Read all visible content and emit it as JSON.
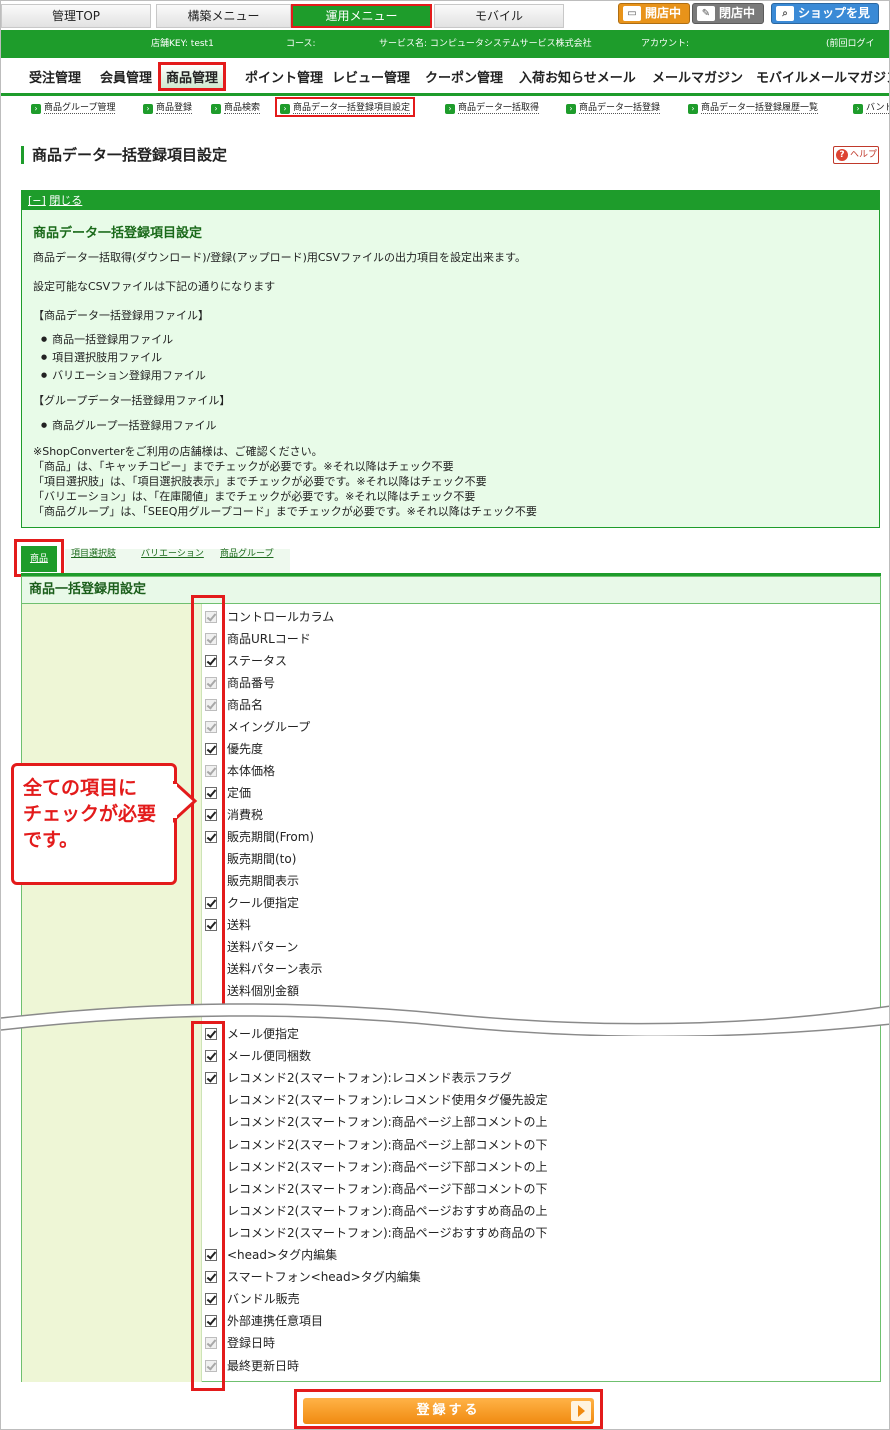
{
  "top_tabs": [
    "管理TOP",
    "構築メニュー",
    "運用メニュー",
    "モバイル"
  ],
  "shop_buttons": [
    "開店中",
    "閉店中",
    "ショップを見る"
  ],
  "info_bar": {
    "store_key": "店舗KEY: test1",
    "course": "コース:",
    "service": "サービス名: コンピュータシステムサービス株式会社",
    "account": "アカウント:",
    "last_login": "(前回ログイ"
  },
  "main_nav": [
    "受注管理",
    "会員管理",
    "商品管理",
    "ポイント管理",
    "レビュー管理",
    "クーポン管理",
    "入荷お知らせメール",
    "メールマガジン",
    "モバイルメールマガジン"
  ],
  "sub_nav": [
    "商品グループ管理",
    "商品登録",
    "商品検索",
    "商品データ一括登録項目設定",
    "商品データ一括取得",
    "商品データ一括登録",
    "商品データ一括登録履歴一覧",
    "バンド"
  ],
  "page": {
    "title": "商品データ一括登録項目設定",
    "help": "ヘルプ"
  },
  "info_box": {
    "toggle": "[−]",
    "close": "閉じる",
    "heading": "商品データ一括登録項目設定",
    "intro": "商品データ一括取得(ダウンロード)/登録(アップロード)用CSVファイルの出力項目を設定出来ます。",
    "available": "設定可能なCSVファイルは下記の通りになります",
    "group1_title": "【商品データ一括登録用ファイル】",
    "group1_items": [
      "商品一括登録用ファイル",
      "項目選択肢用ファイル",
      "バリエーション登録用ファイル"
    ],
    "group2_title": "【グループデータ一括登録用ファイル】",
    "group2_items": [
      "商品グループ一括登録用ファイル"
    ],
    "notes": [
      "※ShopConverterをご利用の店舗様は、ご確認ください。",
      "「商品」は、「キャッチコピー」までチェックが必要です。※それ以降はチェック不要",
      "「項目選択肢」は、「項目選択肢表示」までチェックが必要です。※それ以降はチェック不要",
      "「バリエーション」は、「在庫閾値」までチェックが必要です。※それ以降はチェック不要",
      "「商品グループ」は、「SEEQ用グループコード」までチェックが必要です。※それ以降はチェック不要"
    ]
  },
  "section_tabs": [
    "商品",
    "項目選択肢",
    "バリエーション",
    "商品グループ"
  ],
  "panel_title": "商品一括登録用設定",
  "callout_lines": [
    "全ての項目に",
    "チェックが必要",
    "です。"
  ],
  "fields_top": [
    {
      "label": "コントロールカラム",
      "state": "disabled"
    },
    {
      "label": "商品URLコード",
      "state": "disabled"
    },
    {
      "label": "ステータス",
      "state": "checked"
    },
    {
      "label": "商品番号",
      "state": "disabled"
    },
    {
      "label": "商品名",
      "state": "disabled"
    },
    {
      "label": "メイングループ",
      "state": "disabled"
    },
    {
      "label": "優先度",
      "state": "checked"
    },
    {
      "label": "本体価格",
      "state": "disabled"
    },
    {
      "label": "定価",
      "state": "checked"
    },
    {
      "label": "消費税",
      "state": "checked"
    },
    {
      "label": "販売期間(From)",
      "state": "checked"
    },
    {
      "label": "販売期間(to)",
      "state": "none"
    },
    {
      "label": "販売期間表示",
      "state": "none"
    },
    {
      "label": "クール便指定",
      "state": "checked"
    },
    {
      "label": "送料",
      "state": "checked"
    },
    {
      "label": "送料パターン",
      "state": "none"
    },
    {
      "label": "送料パターン表示",
      "state": "none"
    },
    {
      "label": "送料個別金額",
      "state": "none"
    }
  ],
  "fields_bottom": [
    {
      "label": "メール便指定",
      "state": "checked"
    },
    {
      "label": "メール便同梱数",
      "state": "checked"
    },
    {
      "label": "レコメンド2(スマートフォン):レコメンド表示フラグ",
      "state": "checked"
    },
    {
      "label": "レコメンド2(スマートフォン):レコメンド使用タグ優先設定",
      "state": "none"
    },
    {
      "label": "レコメンド2(スマートフォン):商品ページ上部コメントの上",
      "state": "none"
    },
    {
      "label": "レコメンド2(スマートフォン):商品ページ上部コメントの下",
      "state": "none"
    },
    {
      "label": "レコメンド2(スマートフォン):商品ページ下部コメントの上",
      "state": "none"
    },
    {
      "label": "レコメンド2(スマートフォン):商品ページ下部コメントの下",
      "state": "none"
    },
    {
      "label": "レコメンド2(スマートフォン):商品ページおすすめ商品の上",
      "state": "none"
    },
    {
      "label": "レコメンド2(スマートフォン):商品ページおすすめ商品の下",
      "state": "none"
    },
    {
      "label": "<head>タグ内編集",
      "state": "checked"
    },
    {
      "label": "スマートフォン<head>タグ内編集",
      "state": "checked"
    },
    {
      "label": "バンドル販売",
      "state": "checked"
    },
    {
      "label": "外部連携任意項目",
      "state": "checked"
    },
    {
      "label": "登録日時",
      "state": "disabled"
    },
    {
      "label": "最終更新日時",
      "state": "disabled"
    }
  ],
  "submit_label": "登録する"
}
